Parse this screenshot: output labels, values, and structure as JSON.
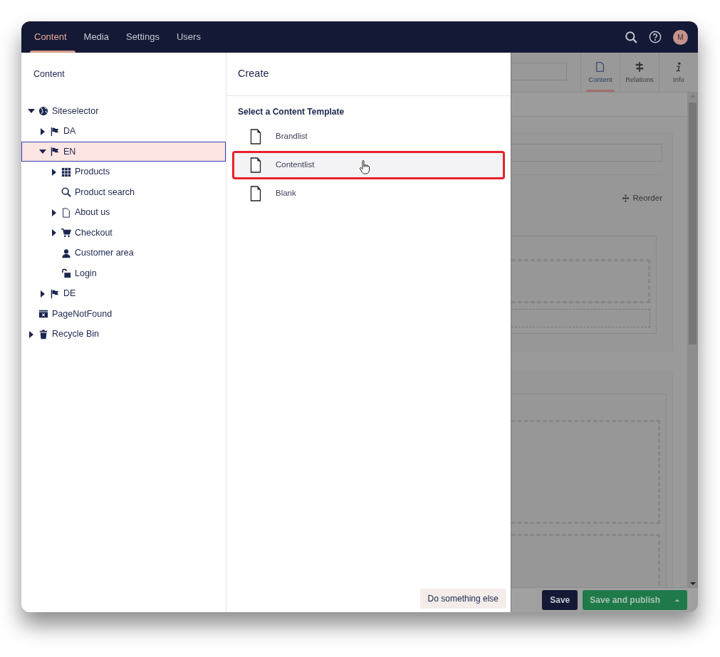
{
  "top_nav": {
    "tabs": [
      {
        "label": "Content",
        "selected": true
      },
      {
        "label": "Media",
        "selected": false
      },
      {
        "label": "Settings",
        "selected": false
      },
      {
        "label": "Users",
        "selected": false
      }
    ],
    "avatar": "M"
  },
  "tree": {
    "title": "Content",
    "items": [
      {
        "label": "Siteselector",
        "kind": "site",
        "expanded": true,
        "selected": false,
        "children": [
          {
            "label": "DA",
            "kind": "language",
            "expanded": false,
            "selected": false
          },
          {
            "label": "EN",
            "kind": "language",
            "expanded": true,
            "selected": true,
            "children": [
              {
                "label": "Products",
                "kind": "product-list",
                "expanded": false,
                "selected": false
              },
              {
                "label": "Product search",
                "kind": "search-page",
                "selected": false
              },
              {
                "label": "About us",
                "kind": "page",
                "expanded": false,
                "selected": false
              },
              {
                "label": "Checkout",
                "kind": "checkout",
                "expanded": false,
                "selected": false
              },
              {
                "label": "Customer area",
                "kind": "account",
                "selected": false
              },
              {
                "label": "Login",
                "kind": "login",
                "selected": false
              }
            ]
          },
          {
            "label": "DE",
            "kind": "language",
            "expanded": false,
            "selected": false
          }
        ]
      },
      {
        "label": "PageNotFound",
        "kind": "error-page",
        "selected": false
      },
      {
        "label": "Recycle Bin",
        "kind": "recycle-bin",
        "expanded": false,
        "selected": false
      }
    ]
  },
  "create_panel": {
    "title": "Create",
    "subtitle": "Select a Content Template",
    "templates": [
      {
        "label": "Brandlist",
        "selected": false
      },
      {
        "label": "Contentlist",
        "selected": true
      },
      {
        "label": "Blank",
        "selected": false
      }
    ],
    "secondary_button": "Do something else"
  },
  "editor": {
    "tabs": [
      {
        "label": "Content",
        "kind": "content",
        "selected": true
      },
      {
        "label": "Relations",
        "kind": "relations",
        "selected": false
      },
      {
        "label": "Info",
        "kind": "info",
        "selected": false
      }
    ],
    "reorder": "Reorder",
    "save_button": "Save",
    "publish_button": "Save and publish"
  }
}
